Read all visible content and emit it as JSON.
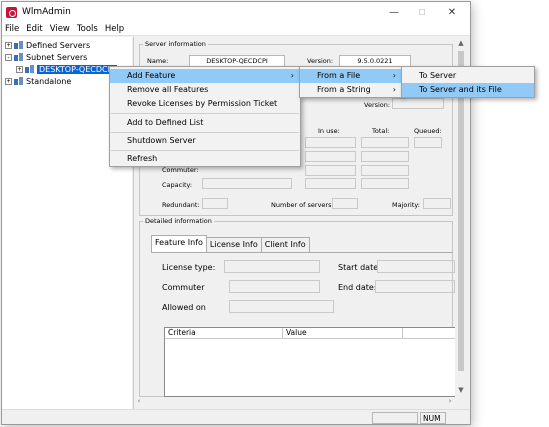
{
  "window": {
    "title": "WlmAdmin",
    "controls": {
      "minimize": "—",
      "maximize": "☐",
      "close": "✕"
    }
  },
  "menubar": [
    "File",
    "Edit",
    "View",
    "Tools",
    "Help"
  ],
  "tree": {
    "defined_servers": "Defined Servers",
    "subnet_servers": "Subnet Servers",
    "selected_server": "DESKTOP-QECDCPI",
    "standalone": "Standalone",
    "expander": "+"
  },
  "server_info": {
    "legend": "Server information",
    "name_label": "Name:",
    "name_value": "DESKTOP-QECDCPI",
    "version_label": "Version:",
    "version_value": "9.5.0.0221",
    "version2_label": "Version:",
    "in_use_label": "In use:",
    "total_label": "Total:",
    "queued_label": "Queued:",
    "commuter_label": "Commuter:",
    "capacity_label": "Capacity:",
    "redundant_label": "Redundant:",
    "num_servers_label": "Number of servers:",
    "majority_label": "Majority:"
  },
  "detail": {
    "legend": "Detailed information",
    "tabs": [
      "Feature Info",
      "License Info",
      "Client Info"
    ],
    "license_type_label": "License type:",
    "start_date_label": "Start date",
    "commuter_label": "Commuter",
    "end_date_label": "End date:",
    "allowed_on_label": "Allowed on",
    "grid_headers": [
      "Criteria",
      "Value"
    ]
  },
  "context_menu": {
    "items": [
      "Add Feature",
      "Remove all Features",
      "Revoke Licenses by Permission Ticket",
      "Add to Defined List",
      "Shutdown Server",
      "Refresh"
    ]
  },
  "submenu1": {
    "items": [
      "From a File",
      "From a String"
    ]
  },
  "submenu2": {
    "items": [
      "To Server",
      "To Server and its File"
    ]
  },
  "status": {
    "num": "NUM"
  },
  "glyphs": {
    "submenu_arrow": "›",
    "scroll_up": "▲",
    "scroll_down": "▼",
    "scroll_left": "‹",
    "scroll_right": "›"
  }
}
